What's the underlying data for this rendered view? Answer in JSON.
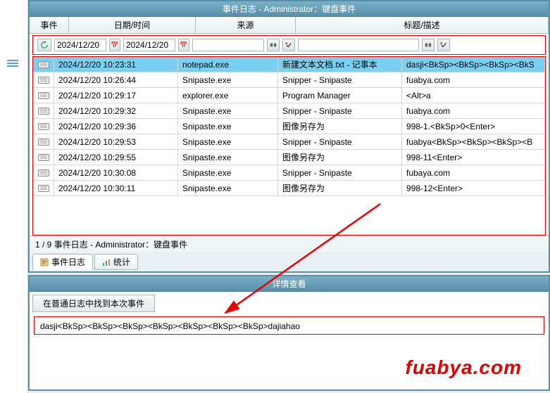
{
  "panel_title": "事件日志 - Administrator：键盘事件",
  "headers": {
    "event": "事件",
    "datetime": "日期/时间",
    "source": "来源",
    "title": "标题/描述"
  },
  "filter": {
    "date_from": "2024/12/20",
    "date_to": "2024/12/20"
  },
  "rows": [
    {
      "datetime": "2024/12/20 10:23:31",
      "source": "notepad.exe",
      "title": "新建文本文档.txt - 记事本",
      "desc": "dasji<BkSp><BkSp><BkSp><BkS",
      "selected": true
    },
    {
      "datetime": "2024/12/20 10:26:44",
      "source": "Snipaste.exe",
      "title": "Snipper - Snipaste",
      "desc": "fuabya.com"
    },
    {
      "datetime": "2024/12/20 10:29:17",
      "source": "explorer.exe",
      "title": "Program Manager",
      "desc": "<Alt>a"
    },
    {
      "datetime": "2024/12/20 10:29:32",
      "source": "Snipaste.exe",
      "title": "Snipper - Snipaste",
      "desc": "fuabya.com"
    },
    {
      "datetime": "2024/12/20 10:29:36",
      "source": "Snipaste.exe",
      "title": "图像另存为",
      "desc": "998-1.<BkSp>0<Enter>"
    },
    {
      "datetime": "2024/12/20 10:29:53",
      "source": "Snipaste.exe",
      "title": "Snipper - Snipaste",
      "desc": "fuabya<BkSp><BkSp><BkSp><B"
    },
    {
      "datetime": "2024/12/20 10:29:55",
      "source": "Snipaste.exe",
      "title": "图像另存为",
      "desc": "998-11<Enter>"
    },
    {
      "datetime": "2024/12/20 10:30:08",
      "source": "Snipaste.exe",
      "title": "Snipper - Snipaste",
      "desc": "fubaya.com"
    },
    {
      "datetime": "2024/12/20 10:30:11",
      "source": "Snipaste.exe",
      "title": "图像另存为",
      "desc": "998-12<Enter>"
    }
  ],
  "status": "1 / 9    事件日志 - Administrator：键盘事件",
  "tabs": {
    "log": "事件日志",
    "stats": "统计"
  },
  "detail_panel_title": "详情查看",
  "detail_button": "在普通日志中找到本次事件",
  "detail_text": "dasji<BkSp><BkSp><BkSp><BkSp><BkSp><BkSp><BkSp>dajiahao",
  "watermark": "fuabya.com"
}
